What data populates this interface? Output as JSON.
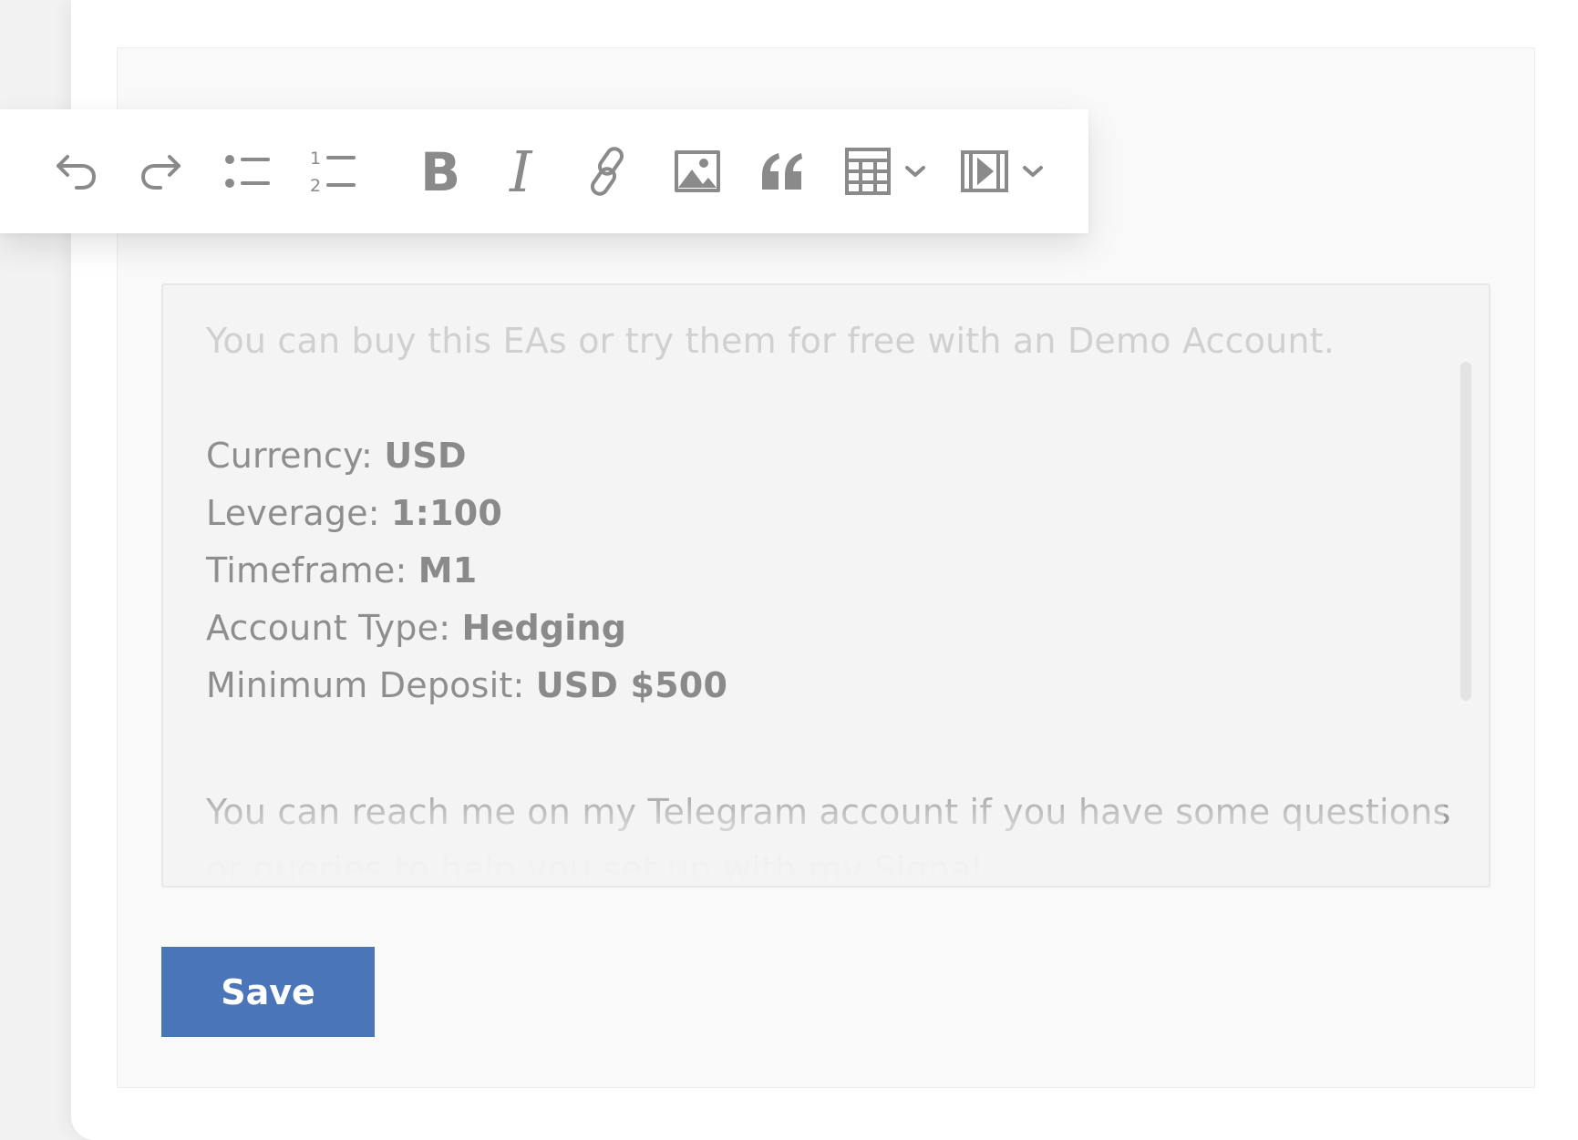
{
  "toolbar": {
    "items": [
      {
        "icon": "undo-icon"
      },
      {
        "icon": "redo-icon"
      },
      {
        "icon": "bulleted-list-icon"
      },
      {
        "icon": "numbered-list-icon"
      },
      {
        "icon": "bold-icon"
      },
      {
        "icon": "italic-icon"
      },
      {
        "icon": "link-icon"
      },
      {
        "icon": "image-icon"
      },
      {
        "icon": "quote-icon"
      },
      {
        "icon": "table-icon",
        "dropdown": true
      },
      {
        "icon": "media-embed-icon",
        "dropdown": true
      }
    ],
    "numbered_list_digits": [
      "1",
      "2"
    ],
    "bold_glyph": "B",
    "italic_glyph": "I"
  },
  "editor": {
    "intro": "You can buy this EAs or try them for free with an Demo Account.",
    "fields": [
      {
        "label": "Currency: ",
        "value": "USD"
      },
      {
        "label": "Leverage: ",
        "value": "1:100"
      },
      {
        "label": "Timeframe: ",
        "value": "M1"
      },
      {
        "label": "Account Type: ",
        "value": "Hedging"
      },
      {
        "label": "Minimum Deposit: ",
        "value": "USD $500"
      }
    ],
    "contact_line1": "You can reach me on my Telegram account if you have some questions",
    "contact_line2": "or queries to help you set up with my Signal"
  },
  "actions": {
    "save_label": "Save"
  },
  "colors": {
    "primary": "#4a76b9",
    "icon": "#8a8a8a"
  }
}
